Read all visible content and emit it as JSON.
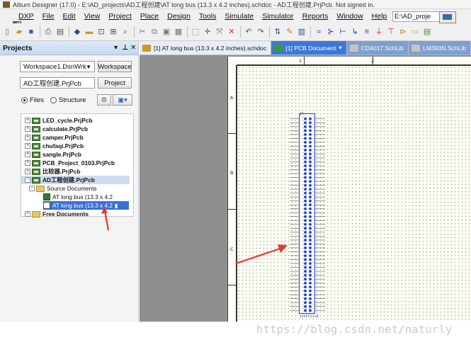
{
  "window": {
    "title": "Altium Designer (17.0) - E:\\AD_projects\\AD工程创建\\AT long bus (13.3 x 4.2 inches).schdoc - AD工程创建.PrjPcb. Not signed in."
  },
  "menu": {
    "items": [
      "DXP",
      "File",
      "Edit",
      "View",
      "Project",
      "Place",
      "Design",
      "Tools",
      "Simulate",
      "Simulator",
      "Reports",
      "Window",
      "Help"
    ],
    "path_value": "E:\\AD_proje"
  },
  "toolbar": {
    "icons": [
      "new-document-icon",
      "open-icon",
      "save-icon",
      "print-icon",
      "print-preview-icon",
      "component-icon",
      "folder-icon",
      "zoom-icon",
      "zoom-area-icon",
      "zoom-fit-icon",
      "cut-icon",
      "copy-icon",
      "paste-icon",
      "rubber-stamp-icon",
      "select-rect-icon",
      "move-icon",
      "cross-select-icon",
      "clear-filter-icon",
      "undo-icon",
      "redo-icon",
      "hierarchy-icon",
      "cross-probe-icon",
      "compile-icon",
      "wire-icon",
      "bus-icon",
      "bus-entry-icon",
      "net-label-icon",
      "net-label-text-icon",
      "gnd-icon",
      "vcc-icon",
      "part-icon",
      "sheet-symbol-icon",
      "port-icon"
    ]
  },
  "projects_panel": {
    "title": "Projects",
    "workspace_value": "Workspace1.DsnWrk",
    "workspace_button": "Workspace",
    "project_value": "AD工程创建.PrjPcb",
    "project_button": "Project",
    "radio_files": "Files",
    "radio_structure": "Structure",
    "tree": [
      {
        "label": "LED_cycle.PrjPcb",
        "type": "project",
        "expander": "+"
      },
      {
        "label": "calculate.PrjPcb",
        "type": "project",
        "expander": "+"
      },
      {
        "label": "camper.PrjPcb",
        "type": "project",
        "expander": "+"
      },
      {
        "label": "chufaqi.PrjPcb",
        "type": "project",
        "expander": "+"
      },
      {
        "label": "sangle.PrjPcb",
        "type": "project",
        "expander": "+"
      },
      {
        "label": "PCB_Project_0103.PrjPcb",
        "type": "project",
        "expander": "+"
      },
      {
        "label": "比较器.PrjPcb",
        "type": "project",
        "expander": "+"
      },
      {
        "label": "AD工程创建.PrjPcb",
        "type": "project",
        "expander": "−",
        "highlighted": true
      },
      {
        "label": "Source Documents",
        "type": "folder",
        "expander": "−"
      },
      {
        "label": "AT long bus (13.3 x 4.2",
        "type": "document"
      },
      {
        "label": "AT long bus (13.3 x 4.2",
        "type": "document",
        "selected": true
      },
      {
        "label": "Free Documents",
        "type": "folder",
        "expander": "+"
      }
    ]
  },
  "tabs": [
    {
      "label": "[1] AT long bus (13.3 x 4.2 inches).schdoc",
      "state": "normal"
    },
    {
      "label": "[1] PCB Document",
      "state": "active"
    },
    {
      "label": "CD4017.SchLib",
      "state": "inactive"
    },
    {
      "label": "LM393N.SchLib",
      "state": "inactive"
    }
  ],
  "sheet": {
    "column_labels": [
      "1",
      "2"
    ],
    "row_labels": [
      "A",
      "B",
      "C"
    ],
    "component_designator": "J?",
    "component_footer": "JCATT-11-0L",
    "pin_rows": 50
  },
  "colors": {
    "accent": "#3c78d8",
    "connector": "#1a3fd8",
    "arrow": "#e23a2c"
  },
  "watermark": "https://blog.csdn.net/naturly"
}
